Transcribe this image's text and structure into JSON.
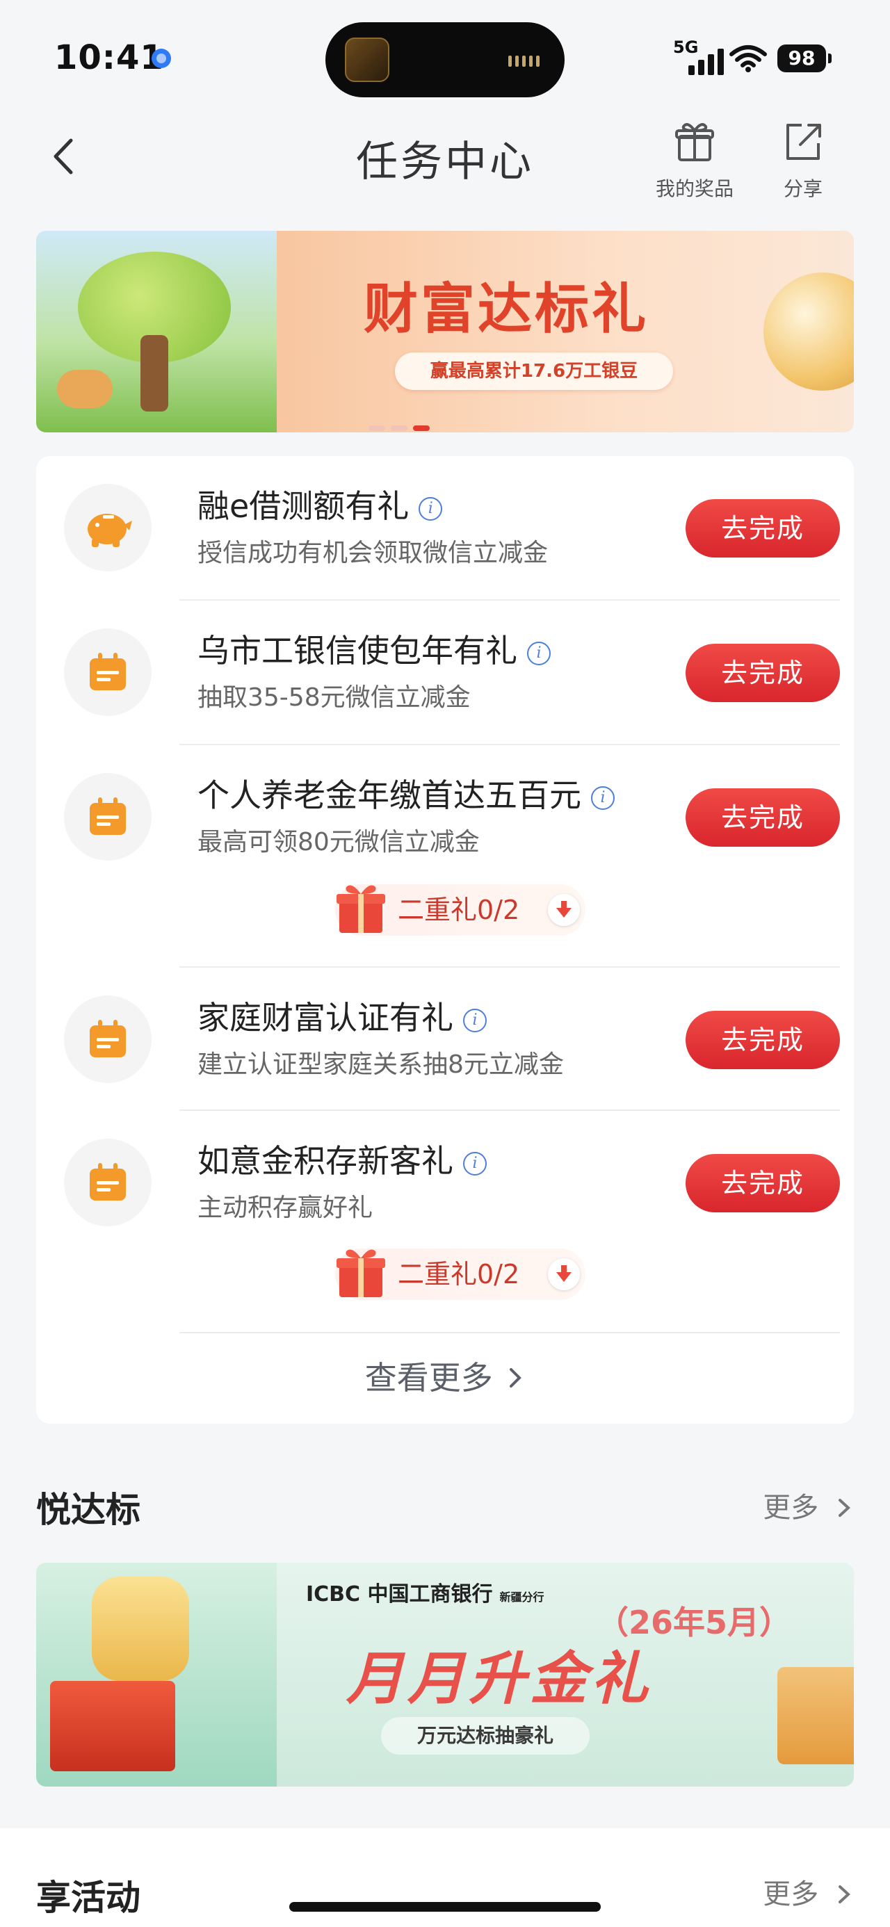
{
  "status_bar": {
    "time": "10:41",
    "network": "5G",
    "battery": "98"
  },
  "nav": {
    "title": "任务中心",
    "actions": [
      {
        "label": "我的奖品",
        "icon": "gift-icon"
      },
      {
        "label": "分享",
        "icon": "share-icon"
      }
    ]
  },
  "banner": {
    "main_text": "财富达标礼",
    "sub_text": "赢最高累计17.6万工银豆",
    "dots_count": 3,
    "active_dot": 2
  },
  "tasks": [
    {
      "title": "融e借测额有礼",
      "desc": "授信成功有机会领取微信立减金",
      "button": "去完成",
      "icon": "piggy-bank-icon"
    },
    {
      "title": "乌市工银信使包年有礼",
      "desc": "抽取35-58元微信立减金",
      "button": "去完成",
      "icon": "calendar-icon"
    },
    {
      "title": "个人养老金年缴首达五百元",
      "desc": "最高可领80元微信立减金",
      "button": "去完成",
      "icon": "calendar-icon",
      "tier": "二重礼0/2"
    },
    {
      "title": "家庭财富认证有礼",
      "desc": "建立认证型家庭关系抽8元立减金",
      "button": "去完成",
      "icon": "calendar-icon"
    },
    {
      "title": "如意金积存新客礼",
      "desc": "主动积存赢好礼",
      "button": "去完成",
      "icon": "calendar-icon",
      "tier": "二重礼0/2"
    }
  ],
  "more_link": "查看更多",
  "section2": {
    "title": "悦达标",
    "more": "更多",
    "banner": {
      "brand": "ICBC 中国工商银行",
      "brand_sub": "新疆分行",
      "date": "（26年5月）",
      "main": "月月升金礼",
      "sub": "万元达标抽豪礼"
    }
  },
  "section3": {
    "title": "享活动",
    "more": "更多"
  },
  "colors": {
    "accent_red": "#e23a2e",
    "icon_orange": "#f39a2b",
    "info_blue": "#4c7fdc"
  }
}
